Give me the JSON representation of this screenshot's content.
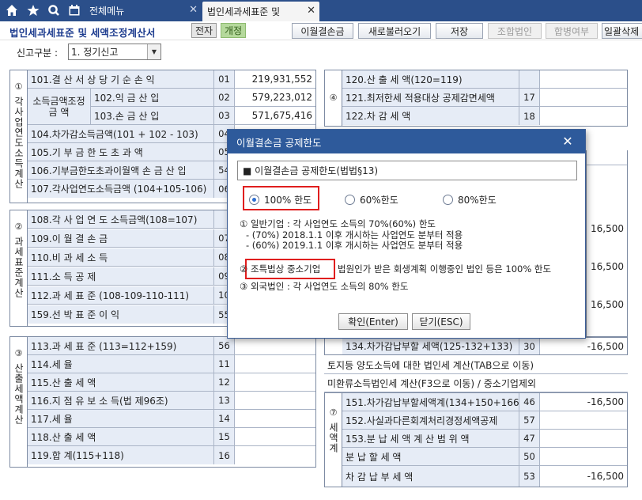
{
  "tabs": {
    "menu_label": "전체메뉴",
    "active_label": "법인세과세표준 및",
    "close_glyph": "✕"
  },
  "header": {
    "title": "법인세과세표준 및 세액조정계산서",
    "badge_prev": "전자",
    "badge_open": "개정",
    "buttons": [
      {
        "label": "이월결손금",
        "disabled": false
      },
      {
        "label": "새로불러오기",
        "disabled": false
      },
      {
        "label": "저장",
        "disabled": false
      },
      {
        "label": "조합법인",
        "disabled": true
      },
      {
        "label": "합병여부",
        "disabled": true
      },
      {
        "label": "일괄삭제",
        "disabled": false
      }
    ]
  },
  "report": {
    "label": "신고구분 :",
    "value": "1. 정기신고"
  },
  "section1": {
    "num": "①",
    "title": "각사업연도소득계산",
    "sub_label": "소득금액조정 금 액",
    "rows": [
      {
        "label": "101.결 산 서 상 당 기 순 손 익",
        "code": "01",
        "value": "219,931,552"
      },
      {
        "label": "102.익 금 산 입",
        "code": "02",
        "value": "579,223,012"
      },
      {
        "label": "103.손 금 산 입",
        "code": "03",
        "value": "571,675,416"
      },
      {
        "label": "104.차가감소득금액(101 + 102 - 103)",
        "code": "04",
        "value": ""
      },
      {
        "label": "105.기 부 금 한 도 초 과 액",
        "code": "05",
        "value": ""
      },
      {
        "label": "106.기부금한도초과이월액 손 금 산 입",
        "code": "54",
        "value": ""
      },
      {
        "label": "107.각사업연도소득금액 (104+105-106)",
        "code": "06",
        "value": ""
      }
    ]
  },
  "section2": {
    "num": "②",
    "title": "과세표준계산",
    "rows": [
      {
        "label": "108.각 사 업 연 도 소득금액(108=107)",
        "code": "",
        "value": ""
      },
      {
        "label": "109.이 월 결 손 금",
        "code": "07",
        "value": ""
      },
      {
        "label": "110.비 과 세 소 득",
        "code": "08",
        "value": ""
      },
      {
        "label": "111.소 득 공 제",
        "code": "09",
        "value": ""
      },
      {
        "label": "112.과 세 표 준 (108-109-110-111)",
        "code": "10",
        "value": ""
      },
      {
        "label": "159.선 박 표 준 이 익",
        "code": "55",
        "value": ""
      }
    ]
  },
  "section3": {
    "num": "③",
    "title": "산출세액계산",
    "rows": [
      {
        "label": "113.과 세 표 준 (113=112+159)",
        "code": "56",
        "value": ""
      },
      {
        "label": "114.세 율",
        "code": "11",
        "value": ""
      },
      {
        "label": "115.산 출 세 액",
        "code": "12",
        "value": ""
      },
      {
        "label": "116.지 점 유 보 소 득(법 제96조)",
        "code": "13",
        "value": ""
      },
      {
        "label": "117.세 율",
        "code": "14",
        "value": ""
      },
      {
        "label": "118.산 출 세 액",
        "code": "15",
        "value": ""
      },
      {
        "label": "119.합 계(115+118)",
        "code": "16",
        "value": ""
      }
    ]
  },
  "section4": {
    "num": "④",
    "rows": [
      {
        "label": "120.산 출 세 액(120=119)",
        "code": "",
        "value": ""
      },
      {
        "label": "121.최저한세 적용대상 공제감면세액",
        "code": "17",
        "value": ""
      },
      {
        "label": "122.차 감 세 액",
        "code": "18",
        "value": ""
      }
    ],
    "right_values": [
      "16,500",
      "16,500",
      "16,500"
    ],
    "row134": {
      "label": "134.차가감납부할 세액(125-132+133)",
      "code": "30",
      "value": "-16,500"
    },
    "land_note": "토지등 양도소득에 대한 법인세 계산(TAB으로 이동)",
    "unrecycled_note": "미환류소득법인세 계산(F3으로 이동) / 중소기업제외"
  },
  "section7": {
    "num": "⑦",
    "title": "세액계",
    "rows": [
      {
        "label": "151.차가감납부할세액계(134+150+166)",
        "code": "46",
        "value": "-16,500"
      },
      {
        "label": "152.사실과다른회계처리경정세액공제",
        "code": "57",
        "value": ""
      },
      {
        "label": "153.분 납 세 액 계 산 범 위 액",
        "code": "47",
        "value": ""
      },
      {
        "label": "분 납 할 세 액",
        "code": "50",
        "value": ""
      },
      {
        "label": "차 감 납 부 세 액",
        "code": "53",
        "value": "-16,500"
      }
    ]
  },
  "dialog": {
    "title": "이월결손금 공제한도",
    "close_glyph": "✕",
    "heading": "■ 이월결손금 공제한도(법법§13)",
    "options": [
      "100% 한도",
      "60%한도",
      "80%한도"
    ],
    "selected_index": 0,
    "note1": "① 일반기업 : 각 사업연도 소득의 70%(60%) 한도",
    "note1a": "- (70%) 2018.1.1 이후 개시하는 사업연도 분부터 적용",
    "note1b": "- (60%) 2019.1.1 이후 개시하는 사업연도 분부터 적용",
    "note2_prefix": "②",
    "note2_highlight": "조특법상 중소기업",
    "note2_rest": "법원인가 받은 회생계획 이행중인 법인 등은 100% 한도",
    "note3": "③ 외국법인 : 각 사업연도 소득의 80% 한도",
    "ok_label": "확인(Enter)",
    "close_label": "닫기(ESC)"
  },
  "colors": {
    "tab_bar": "#2b4f8a",
    "title_text": "#1d3c8f",
    "label_bg": "#e6ecf6",
    "dialog_title": "#2e5a9b",
    "highlight": "#e01e1e"
  }
}
